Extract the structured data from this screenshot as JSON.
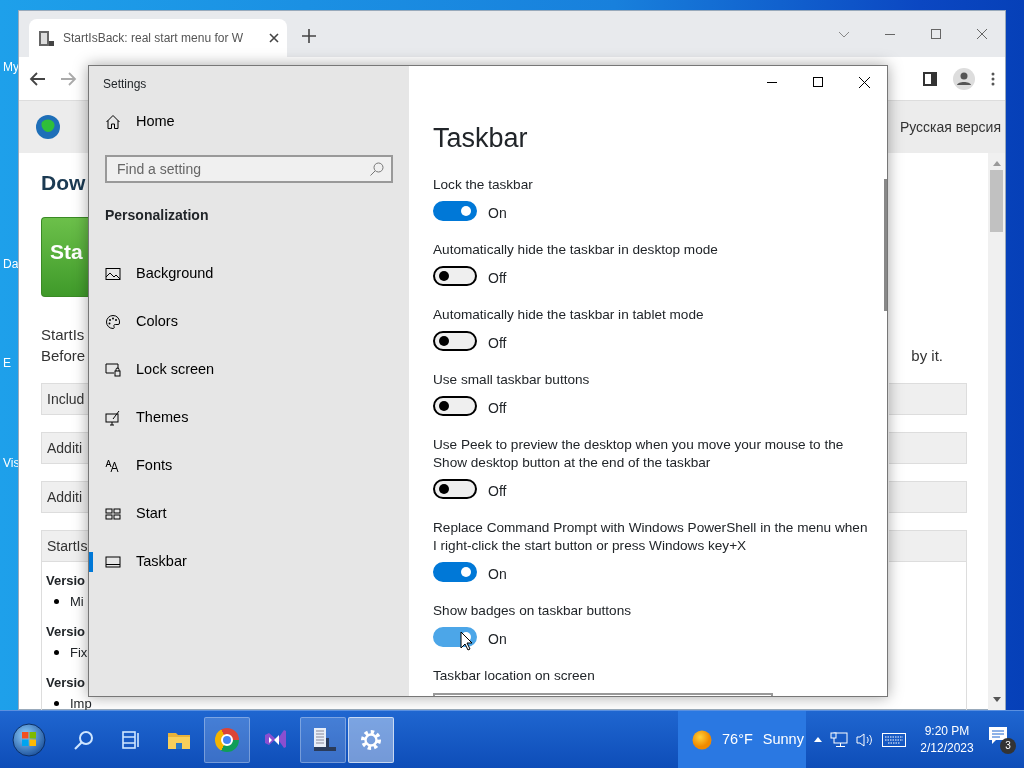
{
  "desktop": {
    "icon_labels": [
      "My",
      "Da",
      "E",
      "Vis"
    ]
  },
  "browser": {
    "tab": {
      "title": "StartIsBack: real start menu for W"
    },
    "page": {
      "language_link": "Русская версия",
      "heading": "Dow",
      "download_button": "Sta",
      "intro": [
        "StartIs",
        "Before"
      ],
      "intro_end": "by it.",
      "sections": [
        "Includ",
        "Additi",
        "Additi",
        "StartIs"
      ],
      "changelog": [
        {
          "version": "Versio",
          "item": "Mi"
        },
        {
          "version": "Versio",
          "item": "Fix"
        },
        {
          "version": "Versio",
          "item": "Imp"
        }
      ]
    }
  },
  "settings": {
    "title": "Settings",
    "home": "Home",
    "search": {
      "placeholder": "Find a setting"
    },
    "category": "Personalization",
    "nav": [
      {
        "label": "Background",
        "kind": "image",
        "selected": false
      },
      {
        "label": "Colors",
        "kind": "palette",
        "selected": false
      },
      {
        "label": "Lock screen",
        "kind": "lock",
        "selected": false
      },
      {
        "label": "Themes",
        "kind": "themes",
        "selected": false
      },
      {
        "label": "Fonts",
        "kind": "fonts",
        "selected": false
      },
      {
        "label": "Start",
        "kind": "start",
        "selected": false
      },
      {
        "label": "Taskbar",
        "kind": "taskbar",
        "selected": true
      }
    ],
    "page_title": "Taskbar",
    "options": [
      {
        "label": "Lock the taskbar",
        "on": true,
        "state": "On",
        "hovered": false
      },
      {
        "label": "Automatically hide the taskbar in desktop mode",
        "on": false,
        "state": "Off",
        "hovered": false
      },
      {
        "label": "Automatically hide the taskbar in tablet mode",
        "on": false,
        "state": "Off",
        "hovered": false
      },
      {
        "label": "Use small taskbar buttons",
        "on": false,
        "state": "Off",
        "hovered": false
      },
      {
        "label": "Use Peek to preview the desktop when you move your mouse to the Show desktop button at the end of the taskbar",
        "on": false,
        "state": "Off",
        "hovered": false
      },
      {
        "label": "Replace Command Prompt with Windows PowerShell in the menu when I right-click the start button or press Windows key+X",
        "on": true,
        "state": "On",
        "hovered": false
      },
      {
        "label": "Show badges on taskbar buttons",
        "on": true,
        "state": "On",
        "hovered": true
      }
    ],
    "next_label": "Taskbar location on screen"
  },
  "taskbar": {
    "apps": [
      {
        "kind": "start",
        "active": false,
        "focused": false
      },
      {
        "kind": "search",
        "active": false,
        "focused": false
      },
      {
        "kind": "taskview",
        "active": false,
        "focused": false
      },
      {
        "kind": "explorer",
        "active": false,
        "focused": false
      },
      {
        "kind": "chrome",
        "active": true,
        "focused": false
      },
      {
        "kind": "vs",
        "active": false,
        "focused": false
      },
      {
        "kind": "startisback",
        "active": true,
        "focused": false
      },
      {
        "kind": "settings",
        "active": true,
        "focused": true
      }
    ],
    "weather": {
      "temperature": "76°F",
      "condition": "Sunny"
    },
    "clock": {
      "time": "9:20 PM",
      "date": "2/12/2023"
    },
    "notifications": "3"
  }
}
